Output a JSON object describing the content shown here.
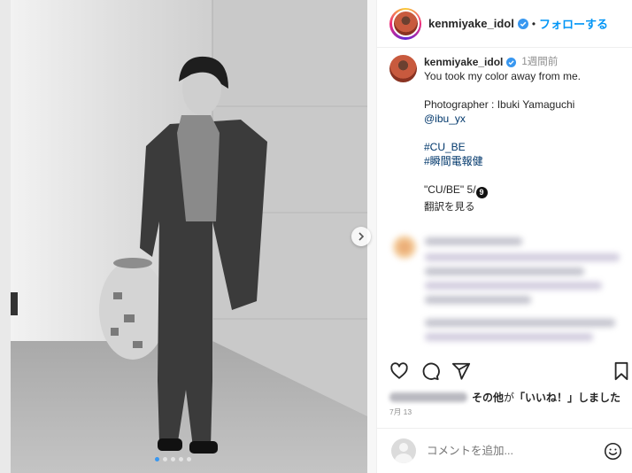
{
  "post": {
    "username": "kenmiyake_idol",
    "follow_label": "フォローする",
    "separator": "•",
    "carousel": {
      "slide_count": 5,
      "active_slide": 1
    }
  },
  "caption": {
    "username": "kenmiyake_idol",
    "time_ago": "1週間前",
    "line1": "You took my color away from me.",
    "photographer": "Photographer : Ibuki Yamaguchi",
    "photographer_handle": "@ibu_yx",
    "hashtag1": "#CU_BE",
    "hashtag2": "#瞬間電報健",
    "series_text": "\"CU/BE\" 5/",
    "series_badge": "9",
    "translate_label": "翻訳を見る"
  },
  "likes": {
    "text_others": "その他",
    "text_ga": "が",
    "text_liked": "「いいね！」しました"
  },
  "date": "7月 13",
  "comment": {
    "placeholder": "コメントを追加..."
  },
  "colors": {
    "accent": "#0095f6",
    "link": "#00376b",
    "verified": "#3897f0",
    "muted": "#8e8e8e"
  },
  "icons": {
    "like": "heart-icon",
    "comment": "comment-icon",
    "share": "paper-plane-icon",
    "save": "bookmark-icon",
    "next": "chevron-right-icon",
    "emoji": "smiley-icon"
  }
}
